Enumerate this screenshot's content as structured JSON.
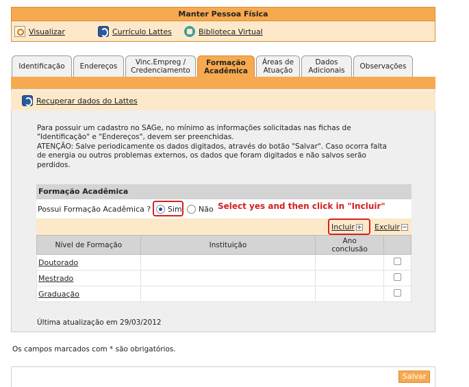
{
  "header": {
    "title": "Manter Pessoa Física",
    "links": [
      {
        "label": "Visualizar",
        "icon": "zoom-icon"
      },
      {
        "label": "Currículo Lattes",
        "icon": "lattes-icon"
      },
      {
        "label": "Biblioteca Virtual",
        "icon": "library-icon"
      }
    ]
  },
  "tabs": [
    {
      "line1": "Identificação",
      "line2": ""
    },
    {
      "line1": "Endereços",
      "line2": ""
    },
    {
      "line1": "Vinc.Empreg /",
      "line2": "Credenciamento"
    },
    {
      "line1": "Formação",
      "line2": "Acadêmica",
      "active": true
    },
    {
      "line1": "Áreas de",
      "line2": "Atuação"
    },
    {
      "line1": "Dados",
      "line2": "Adicionais"
    },
    {
      "line1": "Observações",
      "line2": ""
    }
  ],
  "recover": {
    "label": "Recuperar dados do Lattes",
    "icon": "lattes-icon"
  },
  "info": {
    "line1": "Para possuir um cadastro no SAGe, no mínimo as informações solicitadas nas fichas de",
    "line2": "\"Identificação\" e \"Endereços\", devem ser preenchidas.",
    "line3": "ATENÇÃO: Salve periodicamente os dados digitados, através do botão \"Salvar\". Caso ocorra falta",
    "line4": "de energia ou outros problemas externos, os dados que foram digitados e não salvos serão",
    "line5": "perdidos."
  },
  "section": {
    "title": "Formação Acadêmica",
    "question": "Possui Formação Acadêmica ?",
    "option_yes": "Sim",
    "option_no": "Não",
    "selected": "Sim",
    "annotation": "Select yes and then click in \"Incluir\"",
    "include_label": "Incluir",
    "exclude_label": "Excluir"
  },
  "table": {
    "headers": {
      "level": "Nível de Formação",
      "institution": "Instituição",
      "year_1": "Ano",
      "year_2": "conclusão"
    },
    "rows": [
      {
        "level": "Doutorado",
        "institution": "",
        "year": ""
      },
      {
        "level": "Mestrado",
        "institution": "",
        "year": ""
      },
      {
        "level": "Graduação",
        "institution": "",
        "year": ""
      }
    ]
  },
  "last_update": "Última atualização em 29/03/2012",
  "required_note": "Os campos marcados com * são obrigatórios.",
  "save_label": "Salvar",
  "colors": {
    "accent": "#f7a94f",
    "light_accent": "#fde9c9",
    "annotation": "#d42020"
  }
}
